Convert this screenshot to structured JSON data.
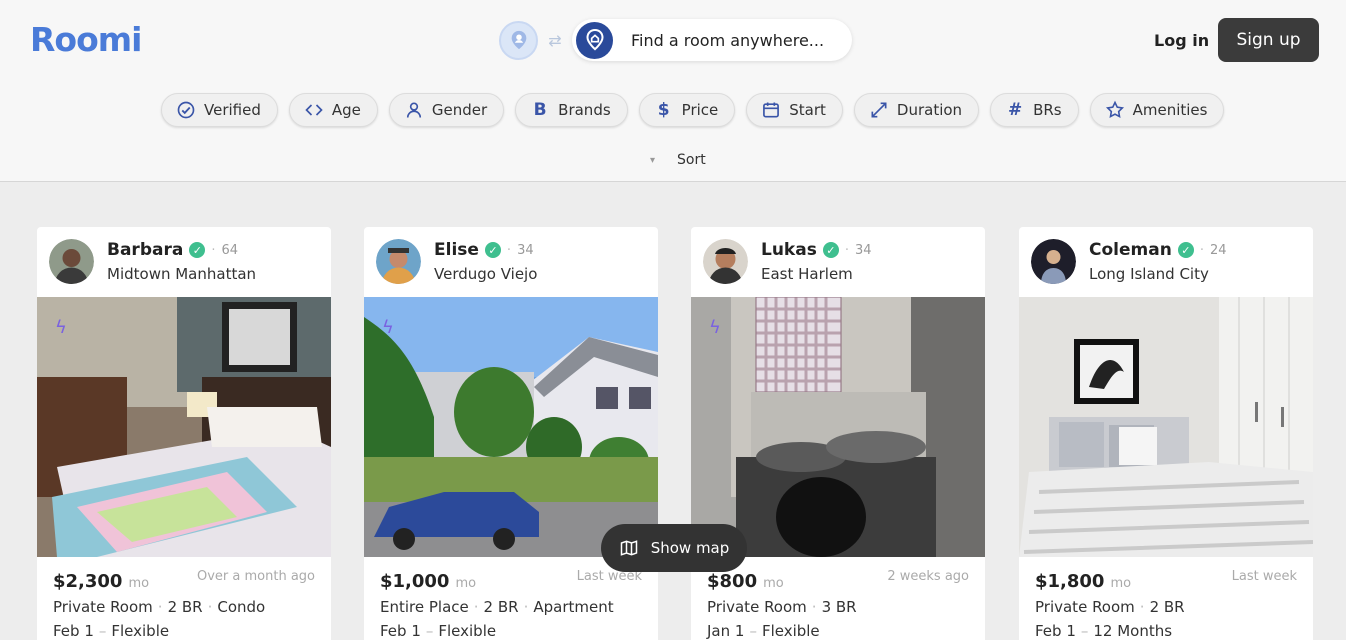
{
  "header": {
    "logo": "Roomi",
    "search_placeholder": "Find a room anywhere...",
    "login_label": "Log in",
    "signup_label": "Sign up"
  },
  "filters": [
    {
      "label": "Verified",
      "icon": "check-circle-icon"
    },
    {
      "label": "Age",
      "icon": "code-brackets-icon"
    },
    {
      "label": "Gender",
      "icon": "person-icon"
    },
    {
      "label": "Brands",
      "icon": "letter-b-icon"
    },
    {
      "label": "Price",
      "icon": "dollar-icon"
    },
    {
      "label": "Start",
      "icon": "calendar-icon"
    },
    {
      "label": "Duration",
      "icon": "expand-arrows-icon"
    },
    {
      "label": "BRs",
      "icon": "hash-icon"
    },
    {
      "label": "Amenities",
      "icon": "star-icon"
    }
  ],
  "sort_label": "Sort",
  "listings": [
    {
      "name": "Barbara",
      "age": "64",
      "neighborhood": "Midtown Manhattan",
      "price": "$2,300",
      "unit": "mo",
      "posted": "Over a month ago",
      "room_type": "Private Room",
      "bedrooms": "2 BR",
      "property": "Condo",
      "start": "Feb 1",
      "duration": "Flexible"
    },
    {
      "name": "Elise",
      "age": "34",
      "neighborhood": "Verdugo Viejo",
      "price": "$1,000",
      "unit": "mo",
      "posted": "Last week",
      "room_type": "Entire Place",
      "bedrooms": "2 BR",
      "property": "Apartment",
      "start": "Feb 1",
      "duration": "Flexible"
    },
    {
      "name": "Lukas",
      "age": "34",
      "neighborhood": "East Harlem",
      "price": "$800",
      "unit": "mo",
      "posted": "2 weeks ago",
      "room_type": "Private Room",
      "bedrooms": "3 BR",
      "property": "",
      "start": "Jan 1",
      "duration": "Flexible"
    },
    {
      "name": "Coleman",
      "age": "24",
      "neighborhood": "Long Island City",
      "price": "$1,800",
      "unit": "mo",
      "posted": "Last week",
      "room_type": "Private Room",
      "bedrooms": "2 BR",
      "property": "",
      "start": "Feb 1",
      "duration": "12 Months"
    }
  ],
  "show_map_label": "Show map",
  "colors": {
    "brand": "#4a7bd8",
    "verified": "#3fbf8f",
    "instant": "#7a62e0",
    "dark_button": "#3b3b3b"
  }
}
